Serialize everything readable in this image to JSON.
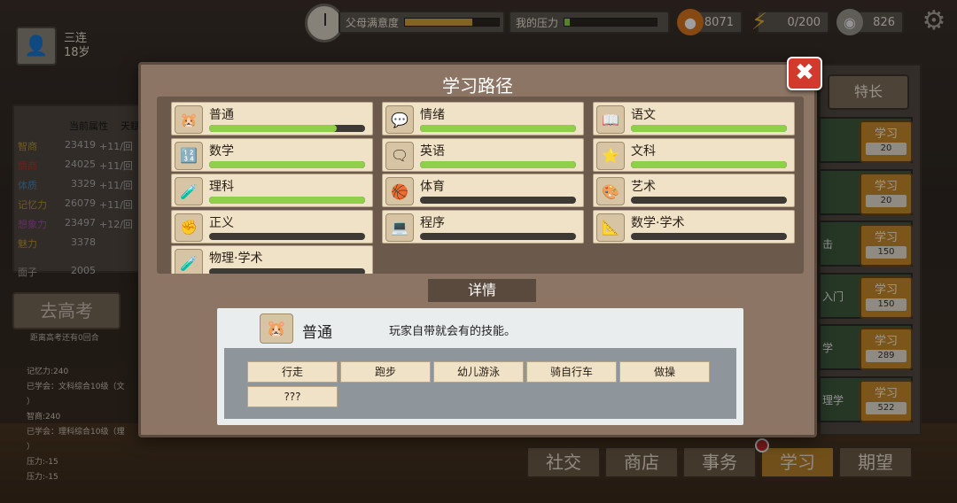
{
  "top": {
    "parent_label": "父母满意度",
    "parent_level": 0.72,
    "pressure_label": "我的压力",
    "pressure_level": 0.06,
    "coins": "8071",
    "energy": "0/200",
    "silver": "826"
  },
  "player": {
    "name": "三连",
    "age": "18岁"
  },
  "stats": {
    "headers": [
      "当前属性",
      "天赋"
    ],
    "rows": [
      {
        "name": "智商",
        "value": "23419",
        "talent": "+11/回"
      },
      {
        "name": "情商",
        "value": "24025",
        "talent": "+11/回"
      },
      {
        "name": "体质",
        "value": "3329",
        "talent": "+11/回"
      },
      {
        "name": "记忆力",
        "value": "26079",
        "talent": "+11/回"
      },
      {
        "name": "想象力",
        "value": "23497",
        "talent": "+12/回"
      },
      {
        "name": "魅力",
        "value": "3378",
        "talent": ""
      },
      {
        "name": "面子",
        "value": "2005",
        "talent": ""
      }
    ]
  },
  "gaokao": {
    "label": "去高考",
    "sub": "距离高考还有0回合"
  },
  "log": [
    "记忆力:240",
    "已学会：文科综合10级（文",
    "）",
    "智商:240",
    "已学会：理科综合10级（理",
    "）",
    "压力:-15",
    "压力:-15"
  ],
  "right": {
    "tezhang": "特长",
    "cards": [
      {
        "label": "",
        "btn": "学习",
        "cost": "20"
      },
      {
        "label": "",
        "btn": "学习",
        "cost": "20"
      },
      {
        "label": "击",
        "btn": "学习",
        "cost": "150"
      },
      {
        "label": "入门",
        "btn": "学习",
        "cost": "150"
      },
      {
        "label": "学",
        "btn": "学习",
        "cost": "289"
      },
      {
        "label": "理学",
        "btn": "学习",
        "cost": "522"
      }
    ]
  },
  "nav": [
    "社交",
    "商店",
    "事务",
    "学习",
    "期望"
  ],
  "modal": {
    "title": "学习路径",
    "close": "✖",
    "skills": [
      {
        "name": "普通",
        "icon": "🐹",
        "level": 0.82
      },
      {
        "name": "情绪",
        "icon": "💬",
        "level": 1.0
      },
      {
        "name": "语文",
        "icon": "📖",
        "level": 1.0
      },
      {
        "name": "数学",
        "icon": "🔢",
        "level": 1.0
      },
      {
        "name": "英语",
        "icon": "🗨",
        "level": 1.0
      },
      {
        "name": "文科",
        "icon": "⭐",
        "level": 1.0
      },
      {
        "name": "理科",
        "icon": "🧪",
        "level": 1.0
      },
      {
        "name": "体育",
        "icon": "🏀",
        "level": 0.0
      },
      {
        "name": "艺术",
        "icon": "🎨",
        "level": 0.0
      },
      {
        "name": "正义",
        "icon": "✊",
        "level": 0.0
      },
      {
        "name": "程序",
        "icon": "💻",
        "level": 0.0
      },
      {
        "name": "数学·学术",
        "icon": "📐",
        "level": 0.0
      },
      {
        "name": "物理·学术",
        "icon": "🧪",
        "level": 0.0
      }
    ],
    "detail_tab": "详情",
    "detail": {
      "icon": "🐹",
      "name": "普通",
      "desc": "玩家自带就会有的技能。",
      "subskills": [
        "行走",
        "跑步",
        "幼儿游泳",
        "骑自行车",
        "做操",
        "???"
      ]
    }
  }
}
